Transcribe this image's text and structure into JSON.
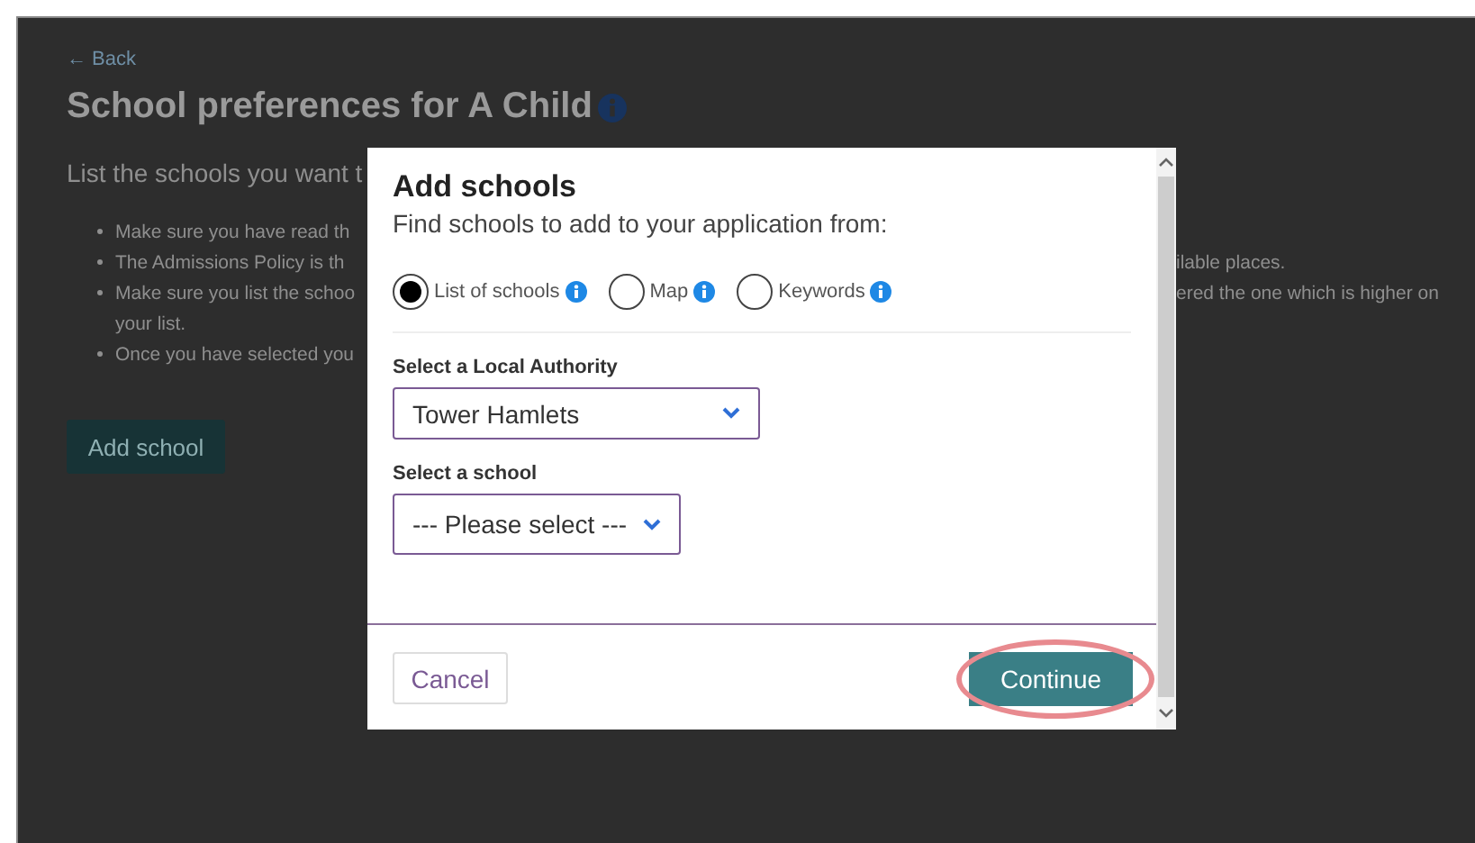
{
  "page": {
    "back_link": "← Back",
    "title": "School preferences for A Child",
    "intro": "List the schools you want t",
    "bullets": [
      {
        "left": "Make sure you have read th"
      },
      {
        "left": "The Admissions Policy is th",
        "right": "ilable places."
      },
      {
        "left": "Make sure you list the schoo",
        "right": "ered the one which is higher on",
        "continuation": "your list."
      },
      {
        "left": "Once you have selected you"
      }
    ],
    "add_button": "Add school"
  },
  "modal": {
    "title": "Add schools",
    "subtitle": "Find schools to add to your application from:",
    "options": [
      {
        "label": "List of schools",
        "selected": true
      },
      {
        "label": "Map",
        "selected": false
      },
      {
        "label": "Keywords",
        "selected": false
      }
    ],
    "fields": [
      {
        "label": "Select a Local Authority",
        "value": "Tower Hamlets"
      },
      {
        "label": "Select a school",
        "value": "--- Please select ---"
      }
    ],
    "cancel": "Cancel",
    "continue": {
      "label": "Continue",
      "highlighted": true
    }
  }
}
